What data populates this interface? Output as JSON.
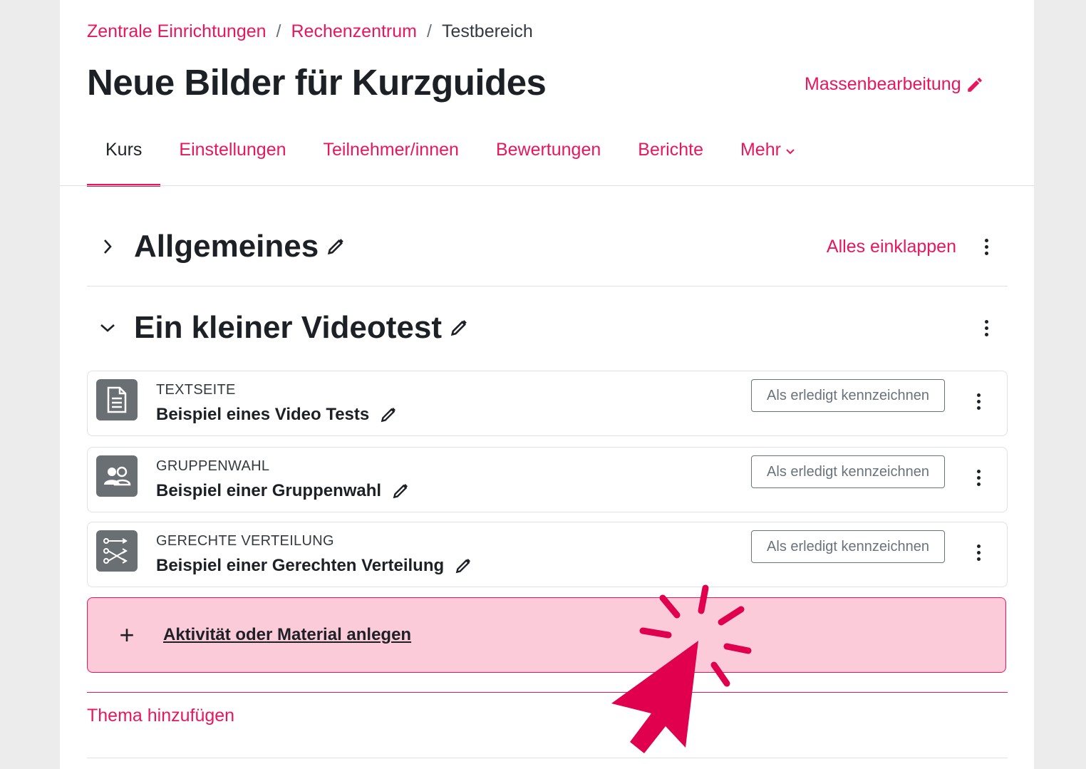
{
  "breadcrumb": {
    "items": [
      "Zentrale Einrichtungen",
      "Rechenzentrum"
    ],
    "separator": "/",
    "current": "Testbereich"
  },
  "page_title": "Neue Bilder für Kurzguides",
  "bulk_edit_label": "Massenbearbeitung",
  "tabs": [
    {
      "label": "Kurs",
      "active": true
    },
    {
      "label": "Einstellungen"
    },
    {
      "label": "Teilnehmer/innen"
    },
    {
      "label": "Bewertungen"
    },
    {
      "label": "Berichte"
    },
    {
      "label": "Mehr"
    }
  ],
  "sections": [
    {
      "title": "Allgemeines",
      "collapsed": true,
      "collapse_all_label": "Alles einklappen"
    },
    {
      "title": "Ein kleiner Videotest",
      "collapsed": false
    }
  ],
  "activities": [
    {
      "type": "TEXTSEITE",
      "name": "Beispiel eines Video Tests",
      "icon": "page-icon",
      "button": "Als erledigt kennzeichnen"
    },
    {
      "type": "GRUPPENWAHL",
      "name": "Beispiel einer Gruppenwahl",
      "icon": "group-choice-icon",
      "button": "Als erledigt kennzeichnen"
    },
    {
      "type": "GERECHTE VERTEILUNG",
      "name": "Beispiel einer Gerechten Verteilung",
      "icon": "allocation-icon",
      "button": "Als erledigt kennzeichnen"
    }
  ],
  "add_activity": {
    "icon": "+",
    "label": "Aktivität oder Material anlegen"
  },
  "add_topic_label": "Thema hinzufügen",
  "colors": {
    "accent": "#e8175d",
    "highlight_bg": "#fccbd9",
    "cursor": "#e0004d"
  }
}
